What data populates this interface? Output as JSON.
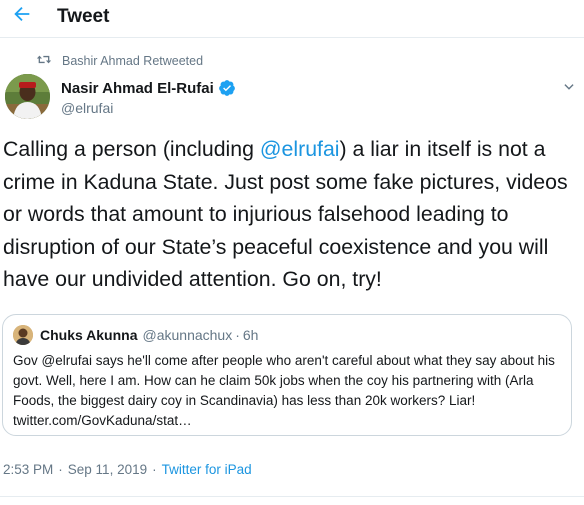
{
  "header": {
    "title": "Tweet",
    "back_icon": "arrow-left-icon",
    "accent_color": "#1da1f2"
  },
  "retweet": {
    "icon": "retweet-icon",
    "text": "Bashir Ahmad Retweeted"
  },
  "author": {
    "name": "Nasir Ahmad El-Rufai",
    "handle": "@elrufai",
    "verified_icon": "verified-badge-icon"
  },
  "tweet": {
    "text_before": "Calling a person (including ",
    "mention": "@elrufai",
    "text_after": ") a liar in itself is not a crime in Kaduna State. Just post some fake pictures, videos or words that amount to injurious falsehood leading to disruption of our State’s peaceful coexistence and you will have our undivided attention. Go on, try!",
    "mention_color": "#1b95e0"
  },
  "quote": {
    "name": "Chuks Akunna",
    "handle": "@akunnachux",
    "dot": "·",
    "time": "6h",
    "text": "Gov @elrufai says he'll come after people who aren't careful about what they say about his govt. Well, here I am. How can he claim 50k jobs when the coy his partnering with (Arla Foods, the biggest dairy coy in Scandinavia) has less than 20k workers? Liar! twitter.com/GovKaduna/stat…"
  },
  "meta": {
    "time": "2:53 PM",
    "sep1": "·",
    "date": "Sep 11, 2019",
    "sep2": "·",
    "source": "Twitter for iPad"
  }
}
